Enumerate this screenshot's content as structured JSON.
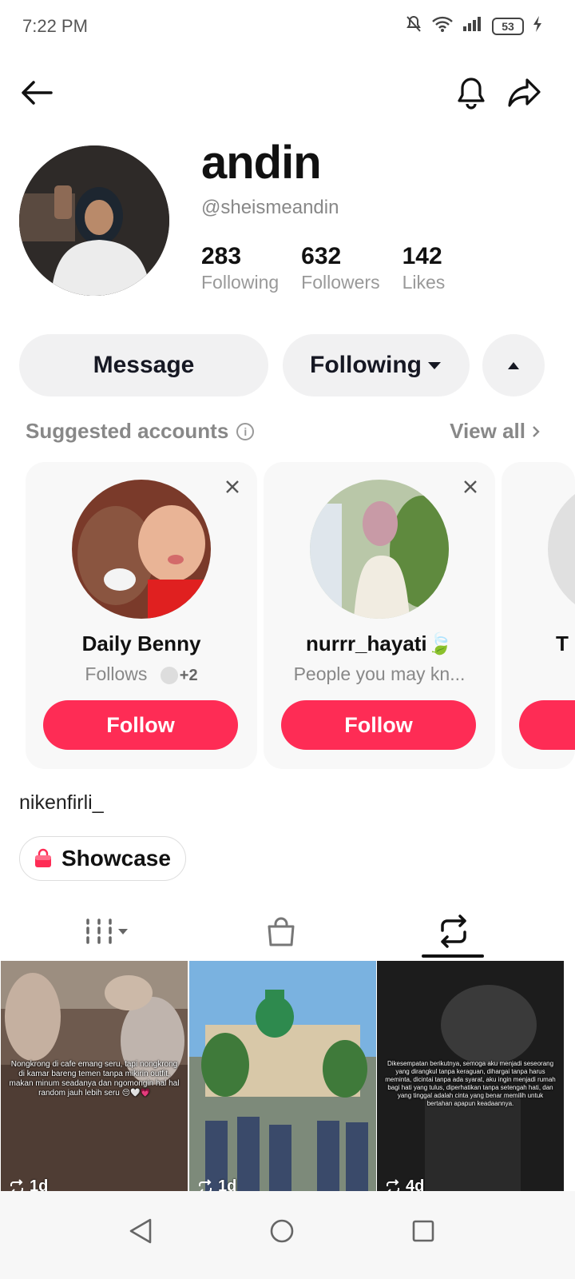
{
  "status_bar": {
    "time": "7:22 PM",
    "battery": "53"
  },
  "profile": {
    "display_name": "andin",
    "username": "@sheismeandin",
    "stats": [
      {
        "value": "283",
        "label": "Following"
      },
      {
        "value": "632",
        "label": "Followers"
      },
      {
        "value": "142",
        "label": "Likes"
      }
    ]
  },
  "actions": {
    "message": "Message",
    "following": "Following"
  },
  "suggested": {
    "title": "Suggested accounts",
    "view_all": "View all",
    "cards": [
      {
        "name": "Daily Benny",
        "subtitle": "Follows",
        "badge": "+2",
        "follow": "Follow"
      },
      {
        "name": "nurrr_hayati🍃",
        "subtitle": "People you may kn...",
        "follow": "Follow"
      },
      {
        "name": "T"
      }
    ]
  },
  "bio": "nikenfirli_",
  "showcase": "Showcase",
  "videos": [
    {
      "caption": "Nongkrong di cafe emang seru, tapi nongkrong di kamar bareng temen tanpa mikirin outfit, makan minum seadanya dan ngomongin hal hal random jauh lebih seru 😔🤍💗",
      "age": "1d"
    },
    {
      "caption": "",
      "age": "1d"
    },
    {
      "caption": "Dikesempatan berikutnya, semoga aku menjadi seseorang yang dirangkul tanpa keraguan, dihargai tanpa harus meminta, dicintai tanpa ada syarat, aku ingin menjadi rumah bagi hati yang tulus, diperhatikan tanpa setengah hati, dan yang tinggal adalah cinta yang benar memilih untuk bertahan apapun keadaannya.",
      "age": "4d"
    }
  ],
  "colors": {
    "accent": "#fe2c55",
    "pill_bg": "#f1f1f2",
    "muted": "#888888"
  }
}
